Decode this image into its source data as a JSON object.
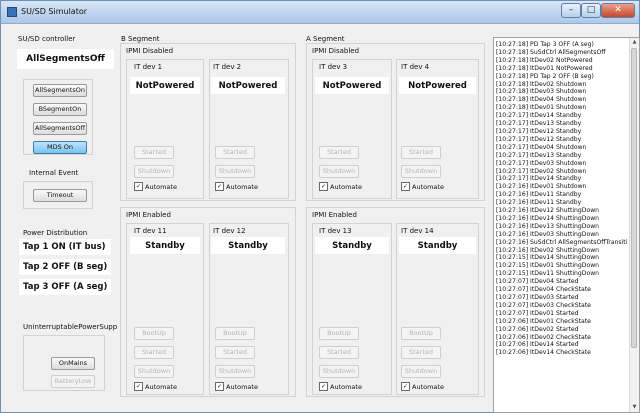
{
  "window": {
    "title": "SU/SD Simulator"
  },
  "controller": {
    "title": "SU/SD controller",
    "state": "AllSegmentsOff",
    "buttons": [
      "AllSegmentsOn",
      "BSegmentOn",
      "AllSegmentsOff",
      "MDS On"
    ],
    "internal_event_label": "Internal Event",
    "timeout_label": "Timeout"
  },
  "power": {
    "title": "Power Distribution",
    "taps": [
      "Tap 1 ON (IT bus)",
      "Tap 2 OFF (B seg)",
      "Tap 3 OFF (A seg)"
    ]
  },
  "ups": {
    "title": "UninterruptablePowerSupp",
    "on_mains_label": "OnMains",
    "battery_low_label": "BatteryLow"
  },
  "segments": {
    "b": {
      "title": "B Segment",
      "disabled_title": "IPMI Disabled",
      "enabled_title": "IPMI Enabled",
      "devs_disabled": [
        {
          "name": "IT dev 1",
          "state": "NotPowered"
        },
        {
          "name": "IT dev 2",
          "state": "NotPowered"
        }
      ],
      "devs_enabled": [
        {
          "name": "IT dev 11",
          "state": "Standby"
        },
        {
          "name": "IT dev 12",
          "state": "Standby"
        }
      ]
    },
    "a": {
      "title": "A Segment",
      "disabled_title": "IPMI Disabled",
      "enabled_title": "IPMI Enabled",
      "devs_disabled": [
        {
          "name": "IT dev 3",
          "state": "NotPowered"
        },
        {
          "name": "IT dev 4",
          "state": "NotPowered"
        }
      ],
      "devs_enabled": [
        {
          "name": "IT dev 13",
          "state": "Standby"
        },
        {
          "name": "IT dev 14",
          "state": "Standby"
        }
      ]
    }
  },
  "dev_controls": {
    "bootup": "BootUp",
    "started": "Started",
    "shutdown": "Shutdown",
    "automate": "Automate"
  },
  "log": [
    "[10:27:18] PD Tap 3 OFF (A seg)",
    "[10:27:18] SuSdCtrl AllSegmentsOff",
    "[10:27:18] ItDev02 NotPowered",
    "[10:27:18] ItDev01 NotPowered",
    "[10:27:18] PD Tap 2 OFF (B seg)",
    "[10:27:18] ItDev02 Shutdown",
    "[10:27:18] ItDev03 Shutdown",
    "[10:27:18] ItDev04 Shutdown",
    "[10:27:18] ItDev01 Shutdown",
    "[10:27:17] ItDev14 Standby",
    "[10:27:17] ItDev13 Standby",
    "[10:27:17] ItDev12 Standby",
    "[10:27:17] ItDev12 Standby",
    "[10:27:17] ItDev04 Shutdown",
    "[10:27:17] ItDev13 Standby",
    "[10:27:17] ItDev03 Shutdown",
    "[10:27:17] ItDev02 Shutdown",
    "[10:27:17] ItDev14 Standby",
    "[10:27:16] ItDev01 Shutdown",
    "[10:27:16] ItDev11 Standby",
    "[10:27:16] ItDev11 Standby",
    "[10:27:16] ItDev12 ShuttingDown",
    "[10:27:16] ItDev14 ShuttingDown",
    "[10:27:16] ItDev13 ShuttingDown",
    "[10:27:16] ItDev03 ShuttingDown",
    "[10:27:16] SuSdCtrl AllSegmentsOffTransiti",
    "[10:27:16] ItDev02 ShuttingDown",
    "[10:27:15] ItDev14 ShuttingDown",
    "[10:27:15] ItDev01 ShuttingDown",
    "[10:27:15] ItDev11 ShuttingDown",
    "[10:27:07] ItDev04 Started",
    "[10:27:07] ItDev04 CheckState",
    "[10:27:07] ItDev03 Started",
    "[10:27:07] ItDev03 CheckState",
    "[10:27:07] ItDev01 Started",
    "[10:27:06] ItDev01 CheckState",
    "[10:27:06] ItDev02 Started",
    "[10:27:06] ItDev02 CheckState",
    "[10:27:06] ItDev14 Started",
    "[10:27:06] ItDev14 CheckState"
  ]
}
